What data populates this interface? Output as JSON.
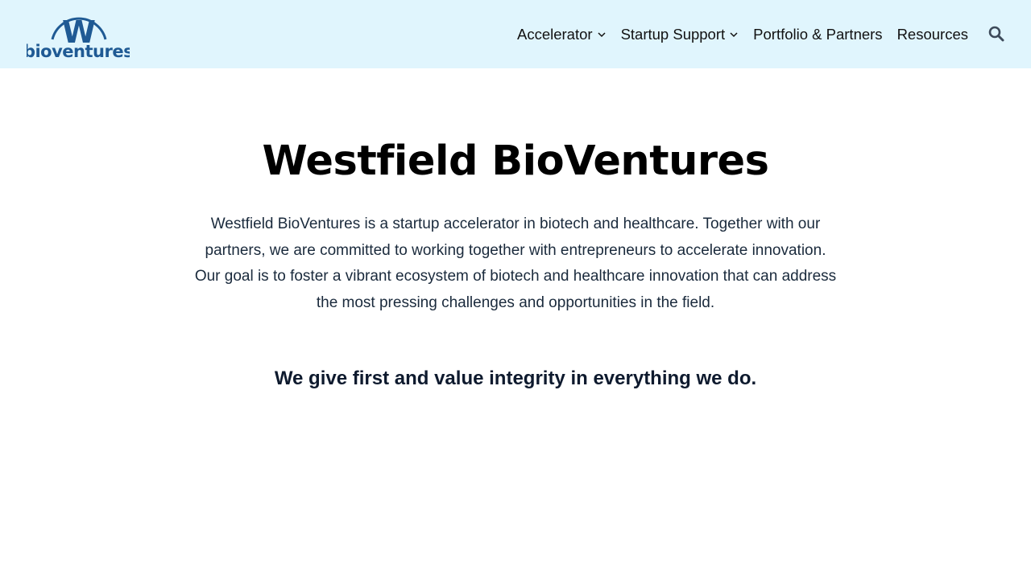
{
  "brand": {
    "logo_text": "bioventures",
    "logo_letter": "W",
    "primary_color": "#1f5a94",
    "header_bg": "#e0f5fd"
  },
  "nav": {
    "items": [
      {
        "label": "Accelerator",
        "has_dropdown": true,
        "icon": "chevron-down-icon"
      },
      {
        "label": "Startup Support",
        "has_dropdown": true,
        "icon": "chevron-down-icon"
      },
      {
        "label": "Portfolio & Partners",
        "has_dropdown": false
      },
      {
        "label": "Resources",
        "has_dropdown": false
      }
    ],
    "search_icon": "search-icon"
  },
  "main": {
    "title": "Westfield BioVentures",
    "intro": "Westfield BioVentures is a startup accelerator in biotech and healthcare. Together with our partners, we are committed to working together with entrepreneurs to accelerate innovation. Our goal is to foster a vibrant ecosystem of biotech and healthcare innovation that can address the most pressing challenges and opportunities in the field.",
    "tagline": "We give first and value integrity in everything we do."
  }
}
